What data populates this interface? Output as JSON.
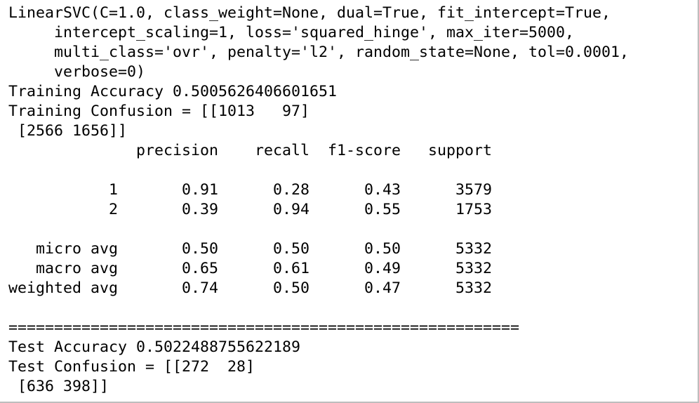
{
  "console": {
    "lines": [
      "LinearSVC(C=1.0, class_weight=None, dual=True, fit_intercept=True,",
      "     intercept_scaling=1, loss='squared_hinge', max_iter=5000,",
      "     multi_class='ovr', penalty='l2', random_state=None, tol=0.0001,",
      "     verbose=0)",
      "Training Accuracy 0.5005626406601651",
      "Training Confusion = [[1013   97]",
      " [2566 1656]]",
      "              precision    recall  f1-score   support",
      "",
      "           1       0.91      0.28      0.43      3579",
      "           2       0.39      0.94      0.55      1753",
      "",
      "   micro avg       0.50      0.50      0.50      5332",
      "   macro avg       0.65      0.61      0.49      5332",
      "weighted avg       0.74      0.50      0.47      5332",
      "",
      "========================================================",
      "Test Accuracy 0.5022488755622189",
      "Test Confusion = [[272  28]",
      " [636 398]]"
    ]
  }
}
